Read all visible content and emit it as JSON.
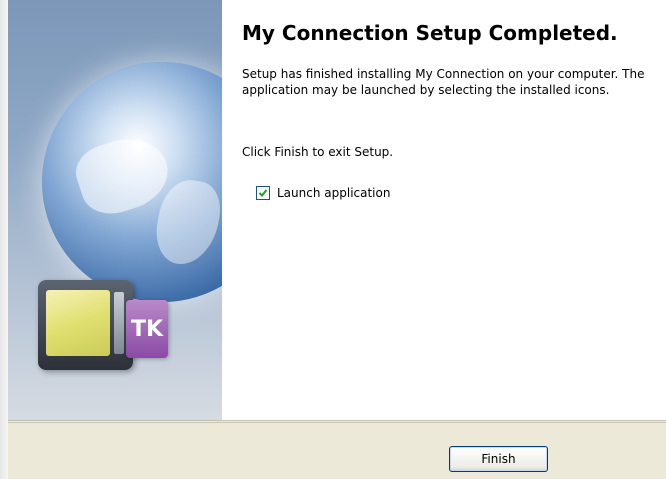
{
  "wizard": {
    "title": "My Connection Setup Completed.",
    "body": "Setup has finished installing My Connection on your computer. The application may be launched by selecting the installed icons.",
    "exit_instruction": "Click Finish to exit Setup.",
    "launch_checkbox": {
      "label": "Launch application",
      "checked": true
    }
  },
  "side_panel": {
    "image": "globe-with-device-illustration",
    "card_text": "TK"
  },
  "buttons": {
    "finish_label": "Finish"
  },
  "colors": {
    "panel_top": "#7c97b8",
    "footer_bg": "#ece9d8",
    "checkbox_check": "#21a121",
    "button_border": "#003c74"
  }
}
